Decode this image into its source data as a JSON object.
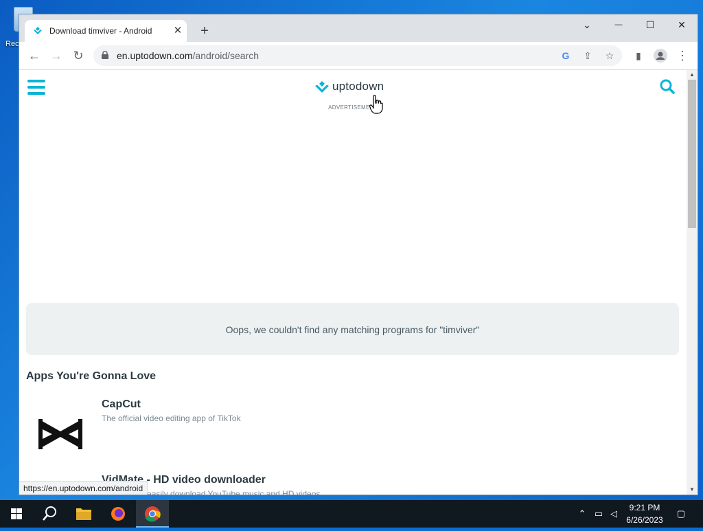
{
  "desktop": {
    "recycle_label": "Rec"
  },
  "browser": {
    "tab_title": "Download timviver - Android",
    "tab_close": "✕",
    "new_tab": "+",
    "controls": {
      "dropdown": "⌄",
      "minimize": "—",
      "maximize": "☐",
      "close": "✕"
    },
    "url_host": "en.uptodown.com",
    "url_path": "/android/search",
    "status_url": "https://en.uptodown.com/android"
  },
  "page": {
    "logo_text": "uptodown",
    "ad_label": "ADVERTISEMENT",
    "no_results": "Oops, we couldn't find any matching programs for \"timviver\"",
    "section_title": "Apps You're Gonna Love",
    "apps": [
      {
        "name": "CapCut",
        "desc": "The official video editing app of TikTok"
      },
      {
        "name": "VidMate - HD video downloader",
        "desc": "Quickly and easily download YouTube music and HD videos"
      }
    ],
    "brand_color": "#0bb4d6"
  },
  "taskbar": {
    "time": "9:21 PM",
    "date": "6/26/2023"
  }
}
